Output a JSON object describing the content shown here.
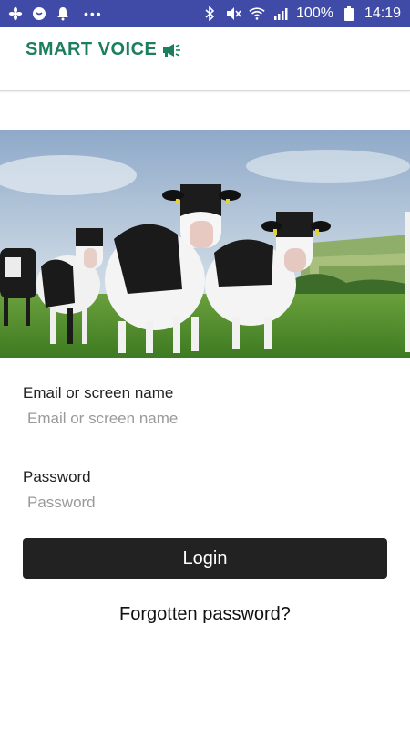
{
  "status_bar": {
    "battery": "100%",
    "time": "14:19",
    "icons_left": [
      "fan-icon",
      "ghost-app-icon",
      "notification-bell-icon",
      "more-dots-icon"
    ],
    "icons_right": [
      "bluetooth-icon",
      "mute-icon",
      "wifi-icon",
      "signal-icon",
      "battery-icon"
    ]
  },
  "header": {
    "brand": "SMART VOICE",
    "brand_color": "#1b7f5d"
  },
  "hero": {
    "description_icon": "cows-field-image"
  },
  "form": {
    "email_label": "Email or screen name",
    "email_placeholder": "Email or screen name",
    "password_label": "Password",
    "password_placeholder": "Password",
    "login_label": "Login",
    "forgot_label": "Forgotten password?"
  },
  "colors": {
    "status_bar": "#3f4ba6",
    "button": "#222222"
  }
}
